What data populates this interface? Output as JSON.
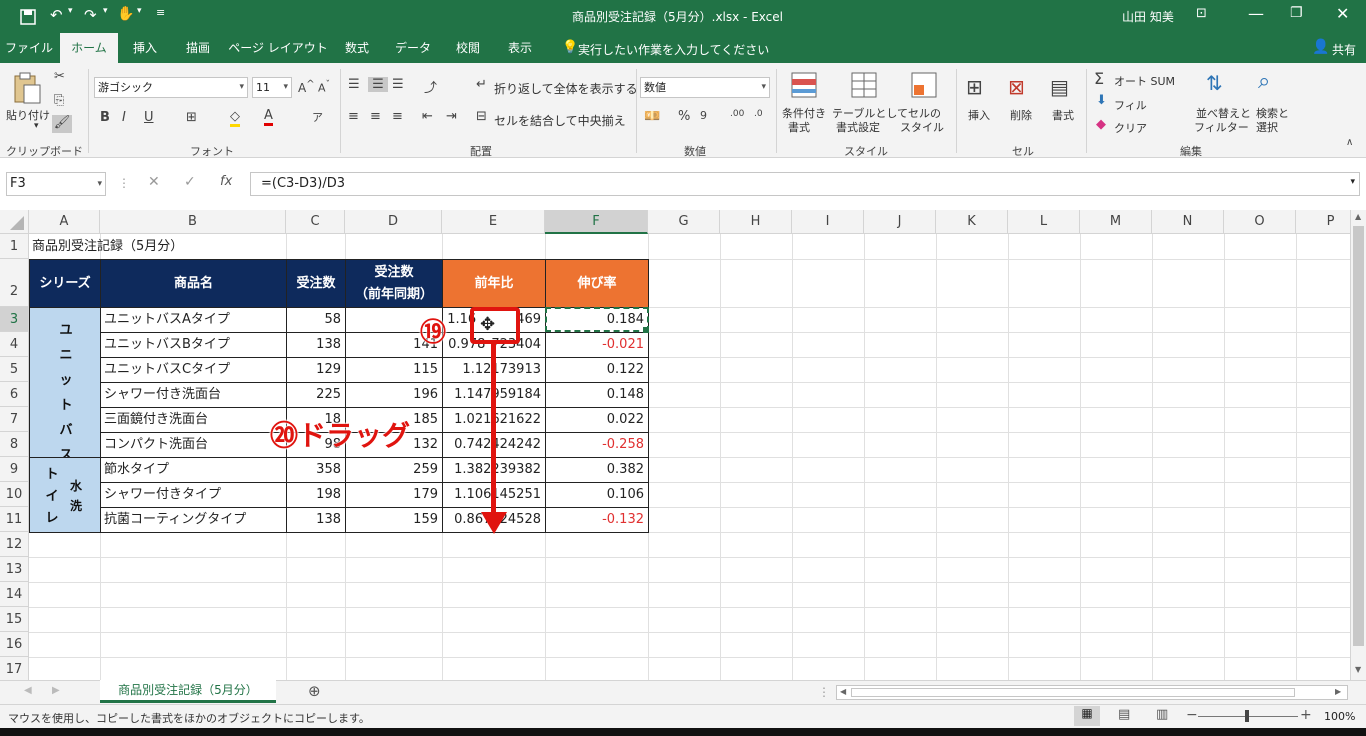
{
  "titlebar": {
    "title": "商品別受注記録（5月分）.xlsx  -  Excel",
    "user": "山田 知美",
    "save_icon": "save-icon",
    "undo_icon": "undo-icon",
    "redo_icon": "redo-icon",
    "touch_icon": "touch-mode-icon"
  },
  "tabs": [
    "ファイル",
    "ホーム",
    "挿入",
    "描画",
    "ページ レイアウト",
    "数式",
    "データ",
    "校閲",
    "表示"
  ],
  "tell_me": "実行したい作業を入力してください",
  "share": "共有",
  "ribbon": {
    "paste": "貼り付け",
    "clipboard": "クリップボード",
    "font_name": "游ゴシック",
    "font_size": "11",
    "font_group": "フォント",
    "wrap": "折り返して全体を表示する",
    "merge": "セルを結合して中央揃え",
    "align_group": "配置",
    "number_format": "数値",
    "number_group": "数値",
    "cond_format": [
      "条件付き",
      "書式"
    ],
    "table_format": [
      "テーブルとして",
      "書式設定"
    ],
    "cell_style": [
      "セルの",
      "スタイル"
    ],
    "style_group": "スタイル",
    "insert": "挿入",
    "delete": "削除",
    "format": "書式",
    "cell_group": "セル",
    "autosum": "オート SUM",
    "fill": "フィル",
    "clear": "クリア",
    "sort": [
      "並べ替えと",
      "フィルター"
    ],
    "find": [
      "検索と",
      "選択"
    ],
    "edit_group": "編集"
  },
  "formula_bar": {
    "name_box": "F3",
    "formula": "=(C3-D3)/D3"
  },
  "columns": [
    "A",
    "B",
    "C",
    "D",
    "E",
    "F",
    "G",
    "H",
    "I",
    "J",
    "K",
    "L",
    "M",
    "N",
    "O",
    "P"
  ],
  "rows": [
    "1",
    "2",
    "3",
    "4",
    "5",
    "6",
    "7",
    "8",
    "9",
    "10",
    "11",
    "12",
    "13",
    "14",
    "15",
    "16",
    "17"
  ],
  "sheet": {
    "title": "商品別受注記録（5月分）",
    "headers": {
      "series": "シリーズ",
      "product": "商品名",
      "orders": "受注数",
      "orders_prev": [
        "受注数",
        "（前年同期）"
      ],
      "ratio": "前年比",
      "growth": "伸び率"
    },
    "series_groups": [
      {
        "name": "ユニットバス"
      },
      {
        "name": "水洗トイレ"
      }
    ],
    "table_rows": [
      {
        "product": "ユニットバスAタイプ",
        "c": "58",
        "d": "",
        "e": "1.16",
        "e2": "469",
        "f": "0.184",
        "neg": false
      },
      {
        "product": "ユニットバスBタイプ",
        "c": "138",
        "d": "141",
        "e": "0.978",
        "e2": "723404",
        "f": "-0.021",
        "neg": true
      },
      {
        "product": "ユニットバスCタイプ",
        "c": "129",
        "d": "115",
        "e": "1.12173913",
        "e2": "",
        "f": "0.122",
        "neg": false
      },
      {
        "product": "シャワー付き洗面台",
        "c": "225",
        "d": "196",
        "e": "1.147959184",
        "e2": "",
        "f": "0.148",
        "neg": false
      },
      {
        "product": "三面鏡付き洗面台",
        "c": "18",
        "d": "185",
        "e": "1.021621622",
        "e2": "",
        "f": "0.022",
        "neg": false
      },
      {
        "product": "コンパクト洗面台",
        "c": "98",
        "d": "132",
        "e": "0.742424242",
        "e2": "",
        "f": "-0.258",
        "neg": true
      },
      {
        "product": "節水タイプ",
        "c": "358",
        "d": "259",
        "e": "1.382239382",
        "e2": "",
        "f": "0.382",
        "neg": false
      },
      {
        "product": "シャワー付きタイプ",
        "c": "198",
        "d": "179",
        "e": "1.106145251",
        "e2": "",
        "f": "0.106",
        "neg": false
      },
      {
        "product": "抗菌コーティングタイプ",
        "c": "138",
        "d": "159",
        "e": "0.867924528",
        "e2": "",
        "f": "-0.132",
        "neg": true
      }
    ]
  },
  "annotations": {
    "step19": "⑲",
    "step20": "⑳ドラッグ"
  },
  "sheet_tab": "商品別受注記録（5月分）",
  "status": "マウスを使用し、コピーした書式をほかのオブジェクトにコピーします。",
  "zoom": "100%",
  "colors": {
    "excel_green": "#217346",
    "header_navy": "#0e2a5c",
    "header_orange": "#ed7331",
    "series_blue": "#bdd7ee",
    "annotation_red": "#e0140f",
    "negative_red": "#e03030"
  }
}
